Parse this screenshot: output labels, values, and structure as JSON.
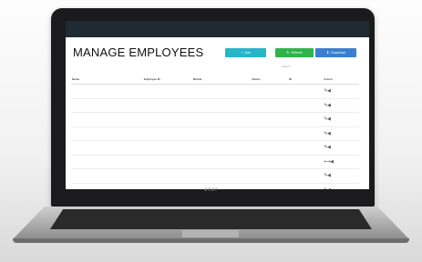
{
  "page": {
    "title": "MANAGE EMPLOYEES"
  },
  "toolbar": {
    "add_label": "Add",
    "refresh_label": "Refresh",
    "download_label": "Download"
  },
  "search": {
    "value": "Search"
  },
  "table": {
    "columns": [
      "Name",
      "Employee ID",
      "Mobile",
      "Status",
      "ID",
      "Action"
    ],
    "rows": [
      [
        "",
        "",
        "",
        "",
        "",
        ""
      ],
      [
        "",
        "",
        "",
        "",
        "",
        ""
      ],
      [
        "",
        "",
        "",
        "",
        "",
        ""
      ],
      [
        "",
        "",
        "",
        "",
        "",
        ""
      ],
      [
        "",
        "",
        "",
        "",
        "",
        ""
      ],
      [
        "",
        "",
        "",
        "",
        "",
        ""
      ],
      [
        "",
        "",
        "",
        "",
        "",
        ""
      ],
      [
        "",
        "",
        "",
        "",
        "",
        ""
      ]
    ]
  },
  "laptop": {
    "brand": "acer"
  }
}
